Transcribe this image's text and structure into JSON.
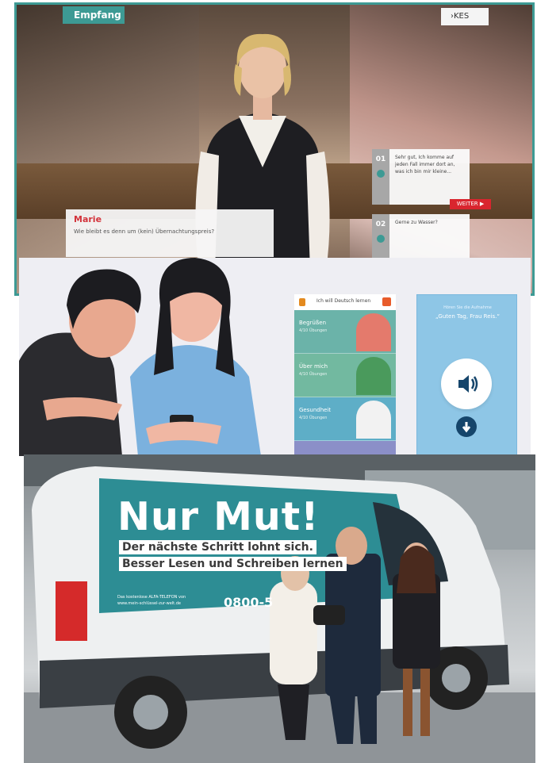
{
  "panel1": {
    "tab": "Empfang",
    "logo": "KES",
    "speaker_name": "Marie",
    "speaker_text": "Wie bleibt es denn um (kein) Übernachtungspreis?",
    "options": [
      {
        "num": "01",
        "text": "Sehr gut, Ich komme auf jeden Fall immer dort an, was ich bin mir kleine..."
      },
      {
        "num": "02",
        "text": "Gerne zu Wasser?"
      }
    ],
    "next_button": "WEITER ▶",
    "accent": "#3d9a94",
    "red": "#d9252e"
  },
  "panel2": {
    "app_title": "Ich will Deutsch lernen",
    "cards": [
      {
        "title": "Begrüßen",
        "sub": "4/10 Übungen",
        "color": "#6bb3a9"
      },
      {
        "title": "Über mich",
        "sub": "4/10 Übungen",
        "color": "#72b9a0"
      },
      {
        "title": "Gesundheit",
        "sub": "4/10 Übungen",
        "color": "#5eaec7"
      },
      {
        "title": "",
        "sub": "",
        "color": "#8b8fc8"
      }
    ],
    "audio_label": "Hören Sie die Aufnahme",
    "audio_quote": "„Guten Tag, Frau Reis.“"
  },
  "panel3": {
    "headline": "Nur Mut!",
    "line1": "Der nächste Schritt lohnt sich.",
    "line2": "Besser Lesen und Schreiben lernen",
    "small1": "Das kostenlose ALFA-TELEFON von",
    "small2": "www.mein-schlüssel-zur-welt.de",
    "phone": "0800-5"
  }
}
